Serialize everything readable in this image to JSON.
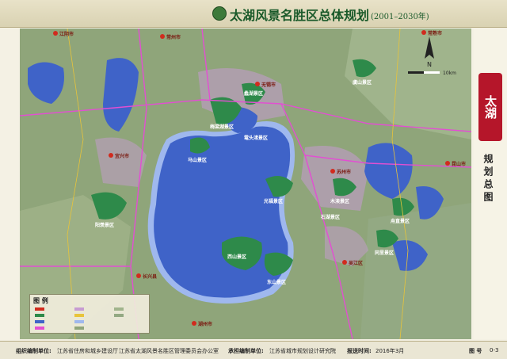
{
  "header": {
    "title": "太湖风景名胜区总体规划",
    "years": "(2001–2030年)"
  },
  "sidebar": {
    "badge": "太湖",
    "subtitle": "规划总图"
  },
  "map": {
    "north_label": "N",
    "scale_label": "10km",
    "cities": [
      "无锡市",
      "苏州市",
      "常州市",
      "湖州市",
      "宜兴市",
      "江阴市",
      "常熟市",
      "昆山市",
      "吴江区",
      "长兴县"
    ],
    "scenic_areas": [
      "梅梁湖景区",
      "蠡湖景区",
      "鼋头渚景区",
      "马山景区",
      "阳羡景区",
      "光福景区",
      "西山景区",
      "东山景区",
      "木渎景区",
      "石湖景区",
      "虞山景区",
      "同里景区",
      "甪直景区"
    ],
    "colors": {
      "lake": "#3f63c8",
      "lake_edge": "#9fb8ee",
      "land": "#8fa57a",
      "scenic": "#2e8a4a",
      "urban": "#c79bd2",
      "road": "#e24fd2",
      "city_marker": "#d12b1e"
    }
  },
  "legend": {
    "title": "图 例"
  },
  "footer": {
    "org_label": "组织编制单位:",
    "org_value": "江苏省住房和城乡建设厅",
    "office": "江苏省太湖风景名胜区管理委员会办公室",
    "maker_label": "承担编制单位:",
    "maker_value": "江苏省城市规划设计研究院",
    "date_label": "报送时间:",
    "date_value": "2016年3月",
    "fig_label": "图 号",
    "fig_value": "0-3"
  }
}
